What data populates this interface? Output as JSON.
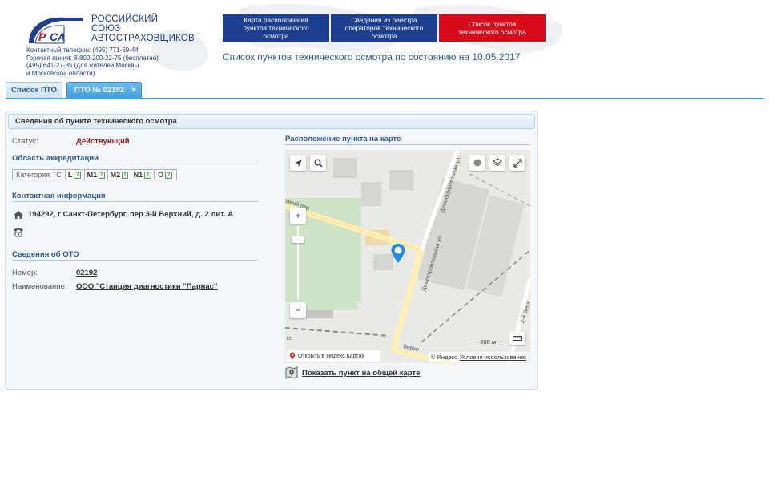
{
  "header": {
    "logo_line1": "РОССИЙСКИЙ",
    "logo_line2": "СОЮЗ",
    "logo_line3": "АВТОСТРАХОВЩИКОВ",
    "contact_phone": "Контактный телефон:  (495) 771-69-44",
    "hotline": "Горячая линия:  8-800-200-22-75  (бесплатно)",
    "hotline_alt": "(495) 641-27-85 (для жителей Москвы",
    "hotline_alt2": "и Московской области)",
    "nav": [
      {
        "line1": "Карта расположения",
        "line2": "пунктов технического",
        "line3": "осмотра"
      },
      {
        "line1": "Сведения из реестра",
        "line2": "операторов технического",
        "line3": "осмотра"
      },
      {
        "line1": "Список пунктов",
        "line2": "технического осмотра",
        "line3": ""
      }
    ],
    "report_date": "Список пунктов технического осмотра по состоянию на 10.05.2017",
    "colors": {
      "nav_blue": "#1e3f8f",
      "nav_red": "#d8091b"
    }
  },
  "tabs": {
    "list": "Список ПТО",
    "current": "ПТО № 02192",
    "close": "×"
  },
  "panel": {
    "title": "Сведения об пункте технического осмотра",
    "status_label": "Статус:",
    "status_value": "Действующий",
    "accreditation_title": "Область аккредитации",
    "category_label": "Категория ТС",
    "categories": [
      "L",
      "M1",
      "M2",
      "N1",
      "O"
    ],
    "help_glyph": "?",
    "contact_title": "Контактная информация",
    "address": "194292, г Санкт-Петербург, пер 3-й Верхний, д. 2 лит. А",
    "oto_title": "Сведения об ОТО",
    "number_label": "Номер:",
    "number_value": "02192",
    "name_label": "Наименование:",
    "name_value": "ООО \"Станция диагностики \"Парнас\""
  },
  "map": {
    "title": "Расположение пункта на карте",
    "open_in_yandex": "Открыть в Яндекс.Картах",
    "copyright": "© Яндекс",
    "terms": "Условия использования",
    "scale": "200 м",
    "zoom_in": "+",
    "zoom_out": "−",
    "street_vertical": "Домостроительная ул.",
    "street_vertical2": "Домостроительная ул.",
    "street_top": "рхний пер",
    "street_bottom": "Верхн",
    "street_right": "2-й Верх",
    "street_edge": "гс",
    "show_on_map": "Показать пункт на общей карте"
  }
}
